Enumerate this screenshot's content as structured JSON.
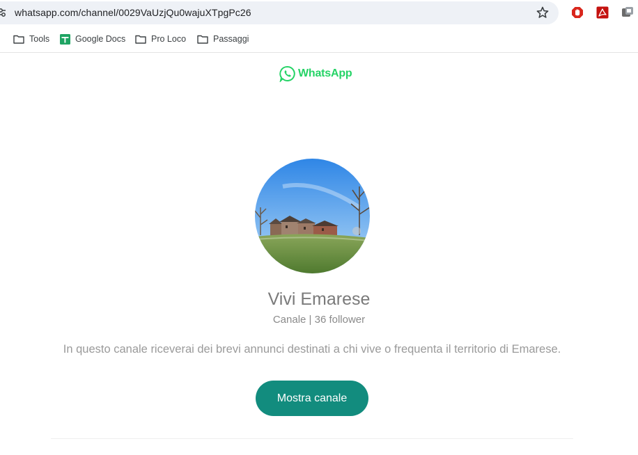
{
  "browser": {
    "url": "whatsapp.com/channel/0029VaUzjQu0wajuXTpgPc26",
    "bookmarks": [
      {
        "label": "Tools",
        "icon": "folder-icon"
      },
      {
        "label": "Google Docs",
        "icon": "google-docs-icon"
      },
      {
        "label": "Pro Loco",
        "icon": "folder-icon"
      },
      {
        "label": "Passaggi",
        "icon": "folder-icon"
      }
    ],
    "extensions": [
      "adblock-icon",
      "acrobat-pdf-icon",
      "puzzle-extension-icon"
    ]
  },
  "page": {
    "logo_text": "WhatsApp",
    "channel_name": "Vivi Emarese",
    "channel_meta": "Canale | 36 follower",
    "description": "In questo canale riceverai dei brevi annunci destinati a chi vive o frequenta il territorio di Emarese.",
    "button_label": "Mostra canale"
  },
  "colors": {
    "whatsapp_green": "#25d366",
    "button_teal": "#128c7e"
  }
}
